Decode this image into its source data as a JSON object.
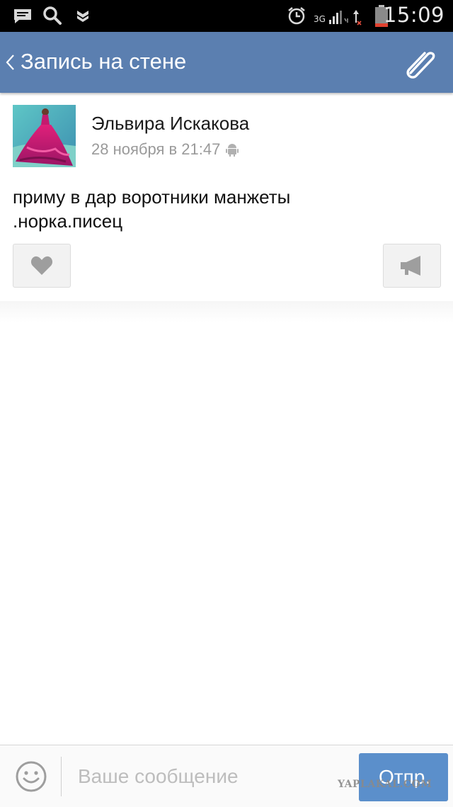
{
  "status_bar": {
    "time": "15:09",
    "network": "3G",
    "icons": [
      "message-icon",
      "search-icon",
      "vk-notification-icon",
      "alarm-icon",
      "signal-icon",
      "battery-icon"
    ]
  },
  "header": {
    "title": "Запись на стене",
    "background_color": "#5b7fb0"
  },
  "post": {
    "author": "Эльвира Искакова",
    "date": "28 ноября в 21:47",
    "text_lines": [
      "приму в дар воротники манжеты",
      ".норка.писец"
    ]
  },
  "composer": {
    "placeholder": "Ваше сообщение",
    "send_label": "Отпр.",
    "send_color": "#5b8fcb"
  },
  "watermark": "YAPLAKAL.COM"
}
